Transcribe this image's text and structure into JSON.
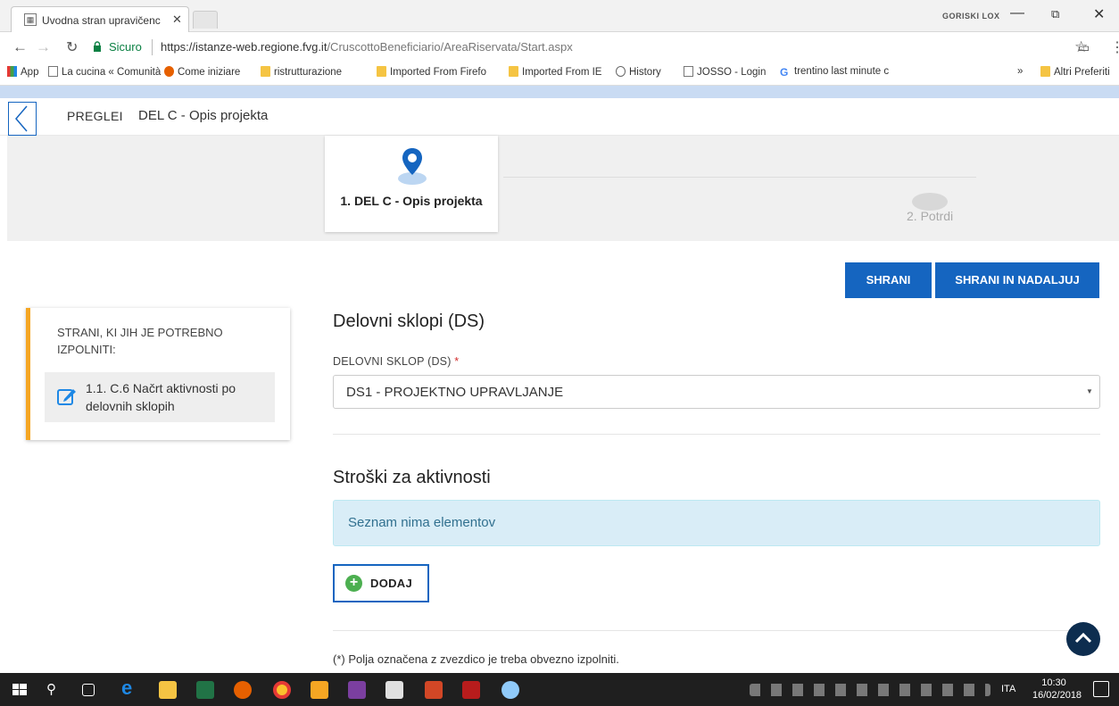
{
  "browser": {
    "tab_title": "Uvodna stran upravičenc",
    "profile_name": "GORISKI LOX",
    "secure_label": "Sicuro",
    "url_base": "https://istanze-web.regione.fvg.it",
    "url_path": "/CruscottoBeneficiario/AreaRiservata/Start.aspx",
    "bookmarks": [
      {
        "label": "App",
        "icon": "apps-grid-icon"
      },
      {
        "label": "La cucina « Comunità",
        "icon": "page-icon"
      },
      {
        "label": "Come iniziare",
        "icon": "firefox-icon"
      },
      {
        "label": "ristrutturazione",
        "icon": "folder-icon"
      },
      {
        "label": "Imported From Firefo",
        "icon": "folder-icon"
      },
      {
        "label": "Imported From IE",
        "icon": "folder-icon"
      },
      {
        "label": "History",
        "icon": "history-icon"
      },
      {
        "label": "JOSSO - Login",
        "icon": "page-icon"
      },
      {
        "label": "trentino last minute c",
        "icon": "google-icon"
      }
    ],
    "bookmarks_overflow": "»",
    "other_bookmarks": "Altri Preferiti"
  },
  "header": {
    "breadcrumb_root": "PREGLEI",
    "breadcrumb_current": "DEL C - Opis projekta"
  },
  "steps": [
    {
      "label": "1. DEL C - Opis projekta",
      "active": true
    },
    {
      "label": "2. Potrdi",
      "active": false
    }
  ],
  "actions": {
    "save": "SHRANI",
    "save_continue": "SHRANI IN NADALJUJ"
  },
  "sidebar": {
    "title": "STRANI, KI JIH JE POTREBNO IZPOLNITI:",
    "item_label": "1.1. C.6 Načrt aktivnosti po delovnih sklopih",
    "accent": "#f5a623"
  },
  "form": {
    "section_title": "Delovni sklopi (DS)",
    "select_label": "DELOVNI SKLOP (DS)",
    "required_mark": "*",
    "select_value": "DS1 - PROJEKTNO UPRAVLJANJE",
    "costs_title": "Stroški za aktivnosti",
    "empty_message": "Seznam nima elementov",
    "add_button": "DODAJ",
    "footnote": "(*) Polja označena z zvezdico je treba obvezno izpolniti."
  },
  "taskbar": {
    "language": "ITA",
    "time": "10:30",
    "date": "16/02/2018"
  },
  "colors": {
    "primary": "#1565c0",
    "accent": "#f5a623",
    "info_bg": "#d9edf7"
  }
}
